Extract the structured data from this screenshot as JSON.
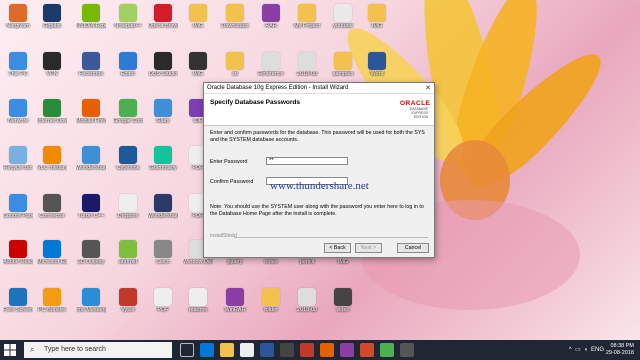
{
  "desktop": {
    "icons": [
      {
        "label": "Nargivam",
        "color": "#e06a2a"
      },
      {
        "label": "Gigabit",
        "color": "#1b3b6b"
      },
      {
        "label": "NVIDIA Experience",
        "color": "#76b900"
      },
      {
        "label": "Notepad++",
        "color": "#a0d060"
      },
      {
        "label": "Opera Browser",
        "color": "#d31d2a"
      },
      {
        "label": "IMG",
        "color": "#f2c14e"
      },
      {
        "label": "Downloads",
        "color": "#f2c14e"
      },
      {
        "label": "RAR",
        "color": "#8a3ea6"
      },
      {
        "label": "My Project",
        "color": "#f2c14e"
      },
      {
        "label": "youtube",
        "color": "#e9e9e9"
      },
      {
        "label": "IMG",
        "color": "#f2c14e"
      },
      {
        "label": "This PC",
        "color": "#3a8de0"
      },
      {
        "label": "VPN",
        "color": "#2a2a2a"
      },
      {
        "label": "Facebook",
        "color": "#3b5998"
      },
      {
        "label": "Editor",
        "color": "#2d7bd4"
      },
      {
        "label": "OBS Studio",
        "color": "#2a2a2a"
      },
      {
        "label": "IMG",
        "color": "#333"
      },
      {
        "label": "sti",
        "color": "#f2c14e"
      },
      {
        "label": "Reference",
        "color": "#ddd"
      },
      {
        "label": "2018-08",
        "color": "#ddd"
      },
      {
        "label": "samples",
        "color": "#f2c14e"
      },
      {
        "label": "Word",
        "color": "#2b579a"
      },
      {
        "label": "Network",
        "color": "#3a8de0"
      },
      {
        "label": "Internet Download",
        "color": "#2a8c3a"
      },
      {
        "label": "Mozilla Firefox",
        "color": "#e66000"
      },
      {
        "label": "Google Chrome",
        "color": "#4caf50"
      },
      {
        "label": "Glary",
        "color": "#3d8fd6"
      },
      {
        "label": "IDE",
        "color": "#7a3fb0"
      },
      {
        "label": "Recycle Bin",
        "color": "#7ab0e0"
      },
      {
        "label": "VLC media player",
        "color": "#f08a00"
      },
      {
        "label": "Wondershare",
        "color": "#3d8fd6"
      },
      {
        "label": "Cyberlink",
        "color": "#1e5a9a"
      },
      {
        "label": "Grammarly",
        "color": "#15c39a"
      },
      {
        "label": "PDF",
        "color": "#eee"
      },
      {
        "label": "Control Panel",
        "color": "#3a8de0"
      },
      {
        "label": "Connector",
        "color": "#555"
      },
      {
        "label": "Turbo C++",
        "color": "#1a1a6a"
      },
      {
        "label": "Dropbox",
        "color": "#eee"
      },
      {
        "label": "Wondershare",
        "color": "#2a3a6a"
      },
      {
        "label": "PDF",
        "color": "#eee"
      },
      {
        "label": "Adobe Reader",
        "color": "#c00"
      },
      {
        "label": "Microsoft Edge",
        "color": "#0078d7"
      },
      {
        "label": "3D Display",
        "color": "#555"
      },
      {
        "label": "android",
        "color": "#7fbf3f"
      },
      {
        "label": "Cisco",
        "color": "#888"
      },
      {
        "label": "Window Desktop",
        "color": "#ddd"
      },
      {
        "label": "jquery",
        "color": "#ddd"
      },
      {
        "label": "notes",
        "color": "#ddd"
      },
      {
        "label": "pencil",
        "color": "#ddd"
      },
      {
        "label": "IMG",
        "color": "#ddd"
      },
      {
        "label": "Free Screen Recorder",
        "color": "#1e73be"
      },
      {
        "label": "PC Booster",
        "color": "#f39c12"
      },
      {
        "label": "imo Messenger",
        "color": "#2a8ed6"
      },
      {
        "label": "Vysor",
        "color": "#c0392b"
      },
      {
        "label": "PDF",
        "color": "#eee"
      },
      {
        "label": "readme",
        "color": "#eee"
      },
      {
        "label": "WinRAR",
        "color": "#8a3ea6"
      },
      {
        "label": "folder",
        "color": "#f2c14e"
      },
      {
        "label": "2018-08",
        "color": "#ddd"
      },
      {
        "label": "video",
        "color": "#444"
      }
    ]
  },
  "dialog": {
    "title": "Oracle Database 10g Express Edition - Install Wizard",
    "heading": "Specify Database Passwords",
    "logo_top": "ORACLE",
    "logo_sub": "DATABASE EXPRESS EDITION",
    "description": "Enter and confirm passwords for the database. This password will be used for both the SYS and the SYSTEM database accounts.",
    "enter_password_label": "Enter Password",
    "enter_password_value": "**",
    "confirm_password_label": "Confirm Password",
    "confirm_password_value": "",
    "note": "Note: You should use the SYSTEM user along with the password you enter here to log in to the Database Home Page after the install is complete.",
    "installshield": "InstallShield",
    "back_label": "< Back",
    "next_label": "Next >",
    "cancel_label": "Cancel"
  },
  "watermark": "www.thundershare.net",
  "taskbar": {
    "search_placeholder": "Type here to search",
    "time": "08:38 PM",
    "date": "29-08-2018",
    "lang": "ENG"
  }
}
